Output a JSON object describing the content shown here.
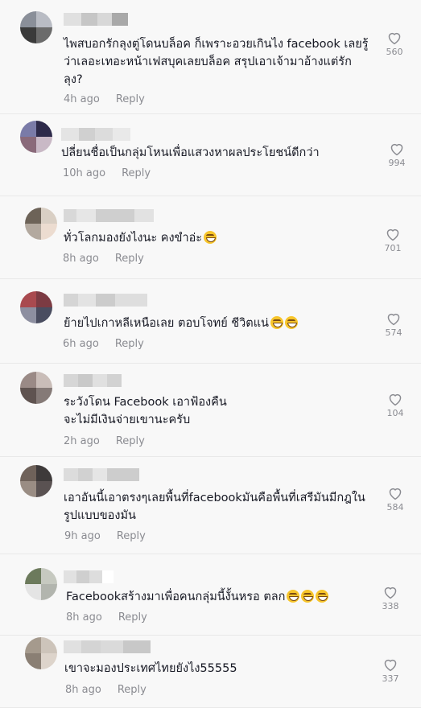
{
  "comments": [
    {
      "text": "ไพสบอกรักลุงตู่โดนบล็อค ก็เพราะอวยเกินไง facebook เลยรู้ว่าเลอะเทอะหน้าเฟสบุคเลยบล็อค สรุปเอาเจ้ามาอ้างแต่รักลุง?",
      "time": "4h ago",
      "reply": "Reply",
      "likes": "560",
      "emoji": 0,
      "avatar_colors": [
        "#8a8f99",
        "#b9bcc4",
        "#3a3a3a",
        "#6b6b6b"
      ],
      "name_colors": [
        "#e0e0e0",
        "#c6c6c6",
        "#d8d8d8",
        "#a9a9a9"
      ]
    },
    {
      "text": "ปลี่ยนชื่อเป็นกลุ่มโหนเพื่อแสวงหาผลประโยชน์ดีกว่า",
      "time": "10h ago",
      "reply": "Reply",
      "likes": "994",
      "emoji": 0,
      "avatar_colors": [
        "#7a7ba8",
        "#2d2a4a",
        "#8a6a7a",
        "#c9b9c6"
      ],
      "name_colors": [
        "#e4e4e4",
        "#d0d0d0",
        "#dcdcdc",
        "#e9e9e9"
      ]
    },
    {
      "text": "ทั่วโลกมองยังไงนะ คงขำอ่ะ",
      "time": "8h ago",
      "reply": "Reply",
      "likes": "701",
      "emoji": 1,
      "avatar_colors": [
        "#6d6358",
        "#d9cfc4",
        "#b3a99f",
        "#ecdcd0"
      ],
      "name_colors": [
        "#d8d8d8",
        "#e6e6e6",
        "#cfcfcf",
        "#e2e2e2"
      ]
    },
    {
      "text": "ย้ายไปเกาหลีเหนือเลย ตอบโจทย์ ชีวิตแน่",
      "time": "6h ago",
      "reply": "Reply",
      "likes": "574",
      "emoji": 2,
      "avatar_colors": [
        "#a94a4f",
        "#7c3b43",
        "#8d8fa0",
        "#4a4d60"
      ],
      "name_colors": [
        "#d5d5d5",
        "#e3e3e3",
        "#cccccc",
        "#dedede"
      ]
    },
    {
      "text": "ระวังโดน Facebook เอาฟ้องคืน\nจะไม่มีเงินจ่ายเขานะครับ",
      "time": "2h ago",
      "reply": "Reply",
      "likes": "104",
      "emoji": 0,
      "avatar_colors": [
        "#9a8a86",
        "#c9bdb8",
        "#5f5350",
        "#857a77"
      ],
      "name_colors": [
        "#d6d6d6",
        "#c9c9c9",
        "#e0e0e0",
        "#d2d2d2"
      ]
    },
    {
      "text": "เอาอันนี้เอาตรงๆเลยพื้นที่facebookมันคือพื้นที่เสรีมันมีกฎในรูปแบบของมัน",
      "time": "9h ago",
      "reply": "Reply",
      "likes": "584",
      "emoji": 0,
      "avatar_colors": [
        "#6f625a",
        "#3e3a3a",
        "#9a8d84",
        "#5a5252"
      ],
      "name_colors": [
        "#dcdcdc",
        "#d1d1d1",
        "#e5e5e5",
        "#cdcdcd"
      ]
    },
    {
      "text": "Facebookสร้างมาเพื่อคนกลุ่มนี้งั้นหรอ ตลก",
      "time": "8h ago",
      "reply": "Reply",
      "likes": "338",
      "emoji": 3,
      "avatar_colors": [
        "#6c7a5c",
        "#c6c9c0",
        "#e4e4e4",
        "#b2b5ae"
      ],
      "name_colors": [
        "#e1e1e1",
        "#cfcfcf",
        "#dddddd",
        "#ffffff"
      ]
    },
    {
      "text": "เขาจะมองประเทศไทยยังไง55555",
      "time": "8h ago",
      "reply": "Reply",
      "likes": "337",
      "emoji": 0,
      "avatar_colors": [
        "#a59a8d",
        "#cdc4ba",
        "#8a7f74",
        "#ddd4cb"
      ],
      "name_colors": [
        "#e0e0e0",
        "#d4d4d4",
        "#dadada",
        "#c8c8c8"
      ]
    }
  ]
}
